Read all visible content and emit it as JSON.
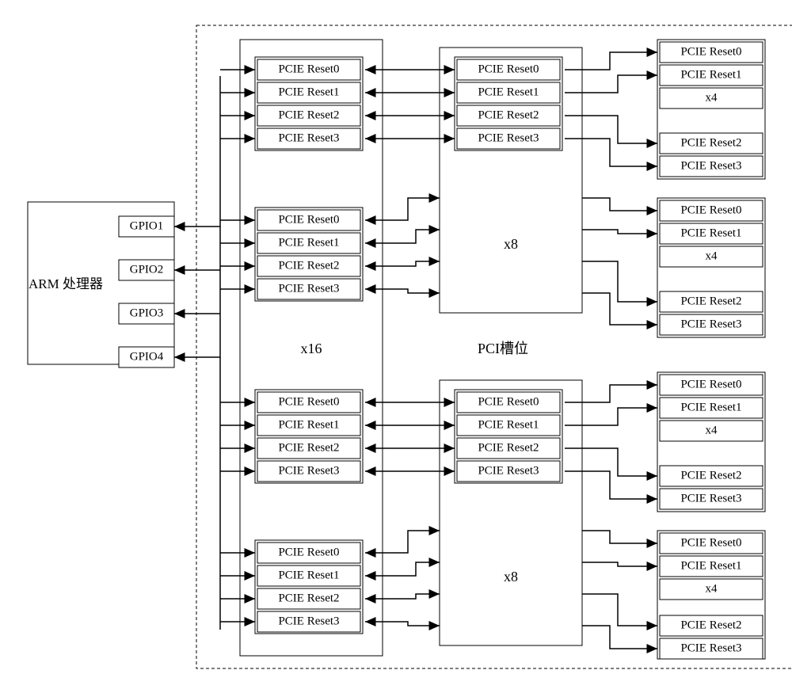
{
  "arm": {
    "title": "ARM 处理器",
    "gpios": [
      "GPIO1",
      "GPIO2",
      "GPIO3",
      "GPIO4"
    ]
  },
  "pci_slot_label": "PCI槽位",
  "x16_label": "x16",
  "x8_label": "x8",
  "x4_label": "x4",
  "resets": [
    "PCIE Reset0",
    "PCIE Reset1",
    "PCIE Reset2",
    "PCIE Reset3"
  ]
}
